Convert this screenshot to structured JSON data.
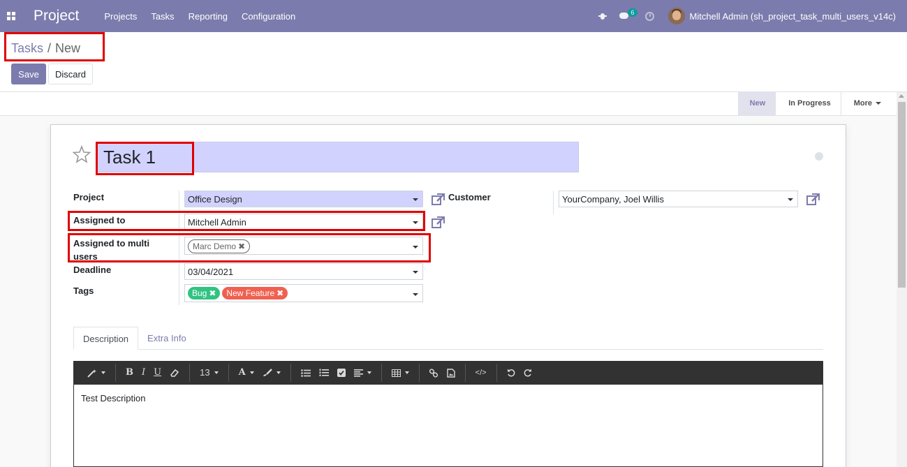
{
  "navbar": {
    "app_title": "Project",
    "menu": [
      "Projects",
      "Tasks",
      "Reporting",
      "Configuration"
    ],
    "chat_count": "6",
    "user": "Mitchell Admin (sh_project_task_multi_users_v14c)",
    "bg_color": "#7c7bad"
  },
  "breadcrumb": {
    "parent": "Tasks",
    "current": "New"
  },
  "buttons": {
    "save": "Save",
    "discard": "Discard"
  },
  "stages": {
    "active": "New",
    "next": "In Progress",
    "more": "More"
  },
  "task": {
    "title": "Task 1",
    "fields": {
      "project_label": "Project",
      "project_value": "Office Design",
      "customer_label": "Customer",
      "customer_value": "YourCompany, Joel Willis",
      "assigned_label": "Assigned to",
      "assigned_value": "Mitchell Admin",
      "multi_users_label_1": "Assigned to multi",
      "multi_users_label_2": "users",
      "multi_users_tags": [
        "Marc Demo"
      ],
      "deadline_label": "Deadline",
      "deadline_value": "03/04/2021",
      "tags_label": "Tags",
      "tags": [
        "Bug",
        "New Feature"
      ]
    }
  },
  "tabs": [
    "Description",
    "Extra Info"
  ],
  "toolbar": {
    "font_size": "13",
    "icons": [
      "magic-wand-icon",
      "bold-icon",
      "italic-icon",
      "underline-icon",
      "eraser-icon",
      "font-color-icon",
      "highlight-brush-icon",
      "bullet-list-icon",
      "numbered-list-icon",
      "checklist-icon",
      "align-icon",
      "table-icon",
      "link-icon",
      "image-icon",
      "code-view-icon",
      "undo-icon",
      "redo-icon"
    ]
  },
  "editor": {
    "content": "Test Description"
  },
  "colors": {
    "primary": "#7c7bad",
    "required_bg": "#d2d2ff",
    "tag_green": "#30c381",
    "tag_red": "#f06050",
    "highlight": "#e00000"
  }
}
